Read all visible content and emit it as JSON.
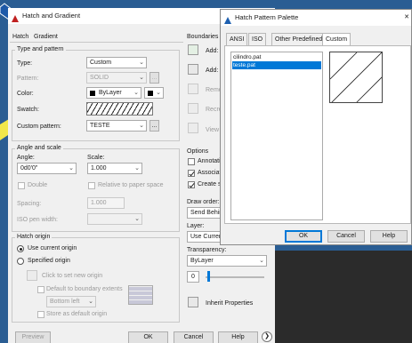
{
  "main_dialog": {
    "title": "Hatch and Gradient",
    "tabs": [
      {
        "label": "Hatch"
      },
      {
        "label": "Gradient"
      }
    ],
    "type_pattern": {
      "group": "Type and pattern",
      "type_label": "Type:",
      "type_value": "Custom",
      "pattern_label": "Pattern:",
      "pattern_value": "SOLID",
      "color_label": "Color:",
      "color_value": "ByLayer",
      "swatch_label": "Swatch:",
      "custom_label": "Custom pattern:",
      "custom_value": "TESTE",
      "ellipsis": "..."
    },
    "angle_scale": {
      "group": "Angle and scale",
      "angle_label": "Angle:",
      "angle_value": "0d0'0\"",
      "scale_label": "Scale:",
      "scale_value": "1.000",
      "double_label": "Double",
      "relative_label": "Relative to paper space",
      "spacing_label": "Spacing:",
      "spacing_value": "1.000",
      "iso_label": "ISO pen width:"
    },
    "origin": {
      "group": "Hatch origin",
      "use_current": "Use current origin",
      "specified": "Specified origin",
      "click_set": "Click to set new origin",
      "default_boundary": "Default to boundary extents",
      "bottom_left": "Bottom left",
      "store_default": "Store as default origin"
    },
    "boundaries": {
      "group": "Boundaries",
      "add1": "Add:",
      "add2": "Add:",
      "remove": "Remo",
      "recreate": "Recre",
      "view": "View"
    },
    "options": {
      "group": "Options",
      "annotative": "Annotativ",
      "associative": "Associati",
      "create_sep": "Create se",
      "draw_order_label": "Draw order:",
      "draw_order_value": "Send Behin",
      "layer_label": "Layer:",
      "layer_value": "Use Curren",
      "transparency_label": "Transparency:",
      "transparency_value": "ByLayer",
      "transparency_num": "0",
      "inherit": "Inherit Properties"
    },
    "buttons": {
      "preview": "Preview",
      "ok": "OK",
      "cancel": "Cancel",
      "help": "Help",
      "more": "❯"
    }
  },
  "palette": {
    "title": "Hatch Pattern Palette",
    "close": "✕",
    "tabs": [
      {
        "label": "ANSI"
      },
      {
        "label": "ISO"
      },
      {
        "label": "Other Predefined"
      },
      {
        "label": "Custom"
      }
    ],
    "files": [
      {
        "name": "cilindro.pat",
        "selected": false
      },
      {
        "name": "teste.pat",
        "selected": true
      }
    ],
    "buttons": {
      "ok": "OK",
      "cancel": "Cancel",
      "help": "Help"
    }
  },
  "colors": {
    "desktop": "#2a5d93",
    "arrow": "#1e5aa8",
    "arrow_yellow": "#f1e74a",
    "select": "#0078d7"
  }
}
